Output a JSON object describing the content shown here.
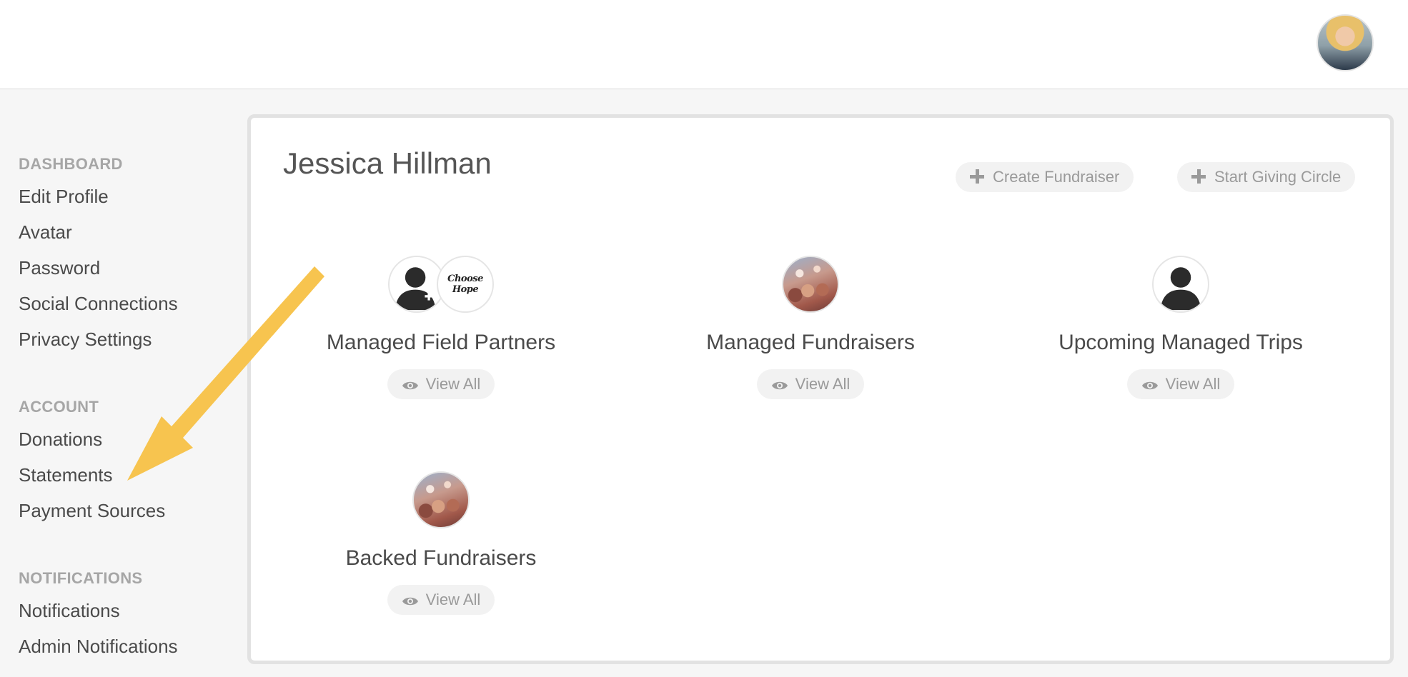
{
  "sidebar": {
    "sections": [
      {
        "heading": "DASHBOARD",
        "items": [
          "Edit Profile",
          "Avatar",
          "Password",
          "Social Connections",
          "Privacy Settings"
        ]
      },
      {
        "heading": "ACCOUNT",
        "items": [
          "Donations",
          "Statements",
          "Payment Sources"
        ]
      },
      {
        "heading": "NOTIFICATIONS",
        "items": [
          "Notifications",
          "Admin Notifications"
        ]
      }
    ]
  },
  "main": {
    "title": "Jessica Hillman",
    "actions": {
      "create_fundraiser": "Create Fundraiser",
      "start_giving_circle": "Start Giving Circle"
    },
    "cards": [
      {
        "title": "Managed Field Partners",
        "button": "View All",
        "icons": [
          "person-plus-icon",
          "choose-hope-logo"
        ],
        "logo_text": "Choose Hope"
      },
      {
        "title": "Managed Fundraisers",
        "button": "View All",
        "icons": [
          "crowd-photo"
        ]
      },
      {
        "title": "Upcoming Managed Trips",
        "button": "View All",
        "icons": [
          "person-icon"
        ]
      },
      {
        "title": "Backed Fundraisers",
        "button": "View All",
        "icons": [
          "crowd-photo"
        ]
      }
    ]
  },
  "annotation": {
    "arrow_color": "#f7c44f",
    "points_to": "Statements"
  }
}
